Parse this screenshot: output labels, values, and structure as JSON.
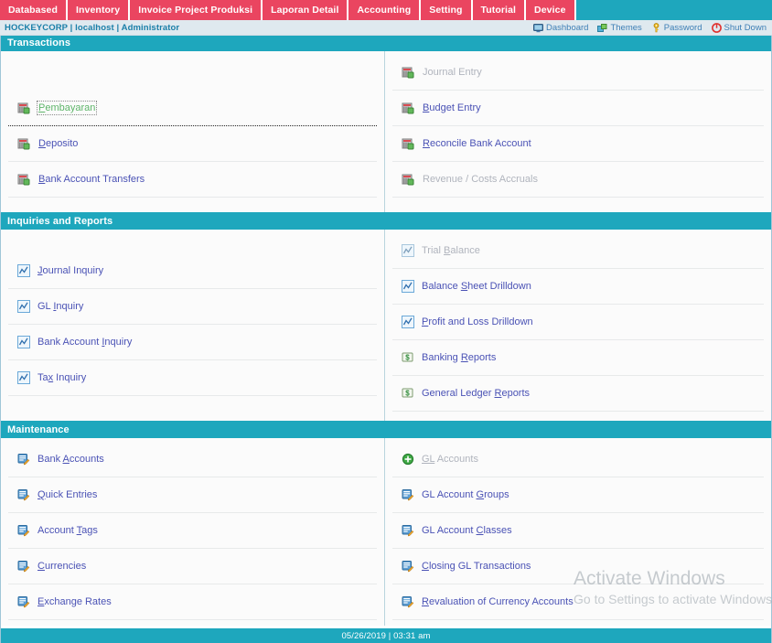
{
  "tabs": [
    {
      "label": "Databased",
      "name": "tab-databased"
    },
    {
      "label": "Inventory",
      "name": "tab-inventory"
    },
    {
      "label": "Invoice Project Produksi",
      "name": "tab-invoice-project-produksi"
    },
    {
      "label": "Laporan Detail",
      "name": "tab-laporan-detail"
    },
    {
      "label": "Accounting",
      "name": "tab-accounting"
    },
    {
      "label": "Setting",
      "name": "tab-setting"
    },
    {
      "label": "Tutorial",
      "name": "tab-tutorial"
    },
    {
      "label": "Device",
      "name": "tab-device"
    }
  ],
  "context": {
    "company": "HOCKEYCORP",
    "host": "localhost",
    "user": "Administrator",
    "breadcrumb": "HOCKEYCORP | localhost | Administrator",
    "links": [
      {
        "label": "Dashboard",
        "icon": "monitor-icon",
        "name": "dashboard-link"
      },
      {
        "label": "Themes",
        "icon": "themes-icon",
        "name": "themes-link"
      },
      {
        "label": "Password",
        "icon": "key-icon",
        "name": "password-link"
      },
      {
        "label": "Shut Down",
        "icon": "power-icon",
        "name": "shutdown-link"
      }
    ]
  },
  "sections": [
    {
      "title": "Transactions",
      "left": [
        {
          "label": "Pembayaran",
          "accesskey": "P",
          "icon": "ledger-icon",
          "state": "focused"
        },
        {
          "label": "Deposito",
          "accesskey": "D",
          "icon": "ledger-icon",
          "state": "enabled"
        },
        {
          "label": "Bank Account Transfers",
          "accesskey": "B",
          "icon": "ledger-icon",
          "state": "enabled"
        }
      ],
      "right": [
        {
          "label": "Journal Entry",
          "accesskey": "",
          "icon": "ledger-icon",
          "state": "disabled"
        },
        {
          "label": "Budget Entry",
          "accesskey": "B",
          "icon": "ledger-icon",
          "state": "enabled"
        },
        {
          "label": "Reconcile Bank Account",
          "accesskey": "R",
          "icon": "ledger-icon",
          "state": "enabled"
        },
        {
          "label": "Revenue / Costs Accruals",
          "accesskey": "",
          "icon": "ledger-icon",
          "state": "disabled"
        }
      ]
    },
    {
      "title": "Inquiries and Reports",
      "left": [
        {
          "label": "Journal Inquiry",
          "accesskey": "J",
          "icon": "chart-inquiry-icon",
          "state": "enabled"
        },
        {
          "label": "GL Inquiry",
          "accesskey": "I",
          "icon": "chart-inquiry-icon",
          "state": "enabled"
        },
        {
          "label": "Bank Account Inquiry",
          "accesskey": "I",
          "icon": "chart-inquiry-icon",
          "state": "enabled"
        },
        {
          "label": "Tax Inquiry",
          "accesskey": "x",
          "icon": "chart-inquiry-icon",
          "state": "enabled"
        }
      ],
      "right": [
        {
          "label": "Trial Balance",
          "accesskey": "B",
          "icon": "chart-inquiry-icon",
          "state": "disabled"
        },
        {
          "label": "Balance Sheet Drilldown",
          "accesskey": "S",
          "icon": "chart-inquiry-icon",
          "state": "enabled"
        },
        {
          "label": "Profit and Loss Drilldown",
          "accesskey": "P",
          "icon": "chart-inquiry-icon",
          "state": "enabled"
        },
        {
          "label": "Banking Reports",
          "accesskey": "R",
          "icon": "money-report-icon",
          "state": "enabled"
        },
        {
          "label": "General Ledger Reports",
          "accesskey": "R",
          "icon": "money-report-icon",
          "state": "enabled"
        }
      ]
    },
    {
      "title": "Maintenance",
      "left": [
        {
          "label": "Bank Accounts",
          "accesskey": "A",
          "icon": "edit-form-icon",
          "state": "enabled"
        },
        {
          "label": "Quick Entries",
          "accesskey": "Q",
          "icon": "edit-form-icon",
          "state": "enabled"
        },
        {
          "label": "Account Tags",
          "accesskey": "T",
          "icon": "edit-form-icon",
          "state": "enabled"
        },
        {
          "label": "Currencies",
          "accesskey": "C",
          "icon": "edit-form-icon",
          "state": "enabled"
        },
        {
          "label": "Exchange Rates",
          "accesskey": "E",
          "icon": "edit-form-icon",
          "state": "enabled"
        }
      ],
      "right": [
        {
          "label": "GL Accounts",
          "accesskey": "GL",
          "icon": "add-circle-icon",
          "state": "disabled"
        },
        {
          "label": "GL Account Groups",
          "accesskey": "G",
          "icon": "edit-form-icon",
          "state": "enabled"
        },
        {
          "label": "GL Account Classes",
          "accesskey": "C",
          "icon": "edit-form-icon",
          "state": "enabled"
        },
        {
          "label": "Closing GL Transactions",
          "accesskey": "C",
          "icon": "edit-form-icon",
          "state": "enabled"
        },
        {
          "label": "Revaluation of Currency Accounts",
          "accesskey": "R",
          "icon": "edit-form-icon",
          "state": "enabled"
        }
      ]
    }
  ],
  "footer": {
    "date": "05/26/2019",
    "time": "03:31 am",
    "text": "05/26/2019 | 03:31 am"
  },
  "watermark": {
    "line1": "Activate Windows",
    "line2": "Go to Settings to activate Windows."
  },
  "colors": {
    "tab_red": "#ea4560",
    "teal": "#1ea7bd",
    "link_blue": "#4a52b5",
    "disabled_gray": "#b0b4bd",
    "focus_green": "#5fb56a",
    "ctx_bg": "#dfe9ef"
  }
}
